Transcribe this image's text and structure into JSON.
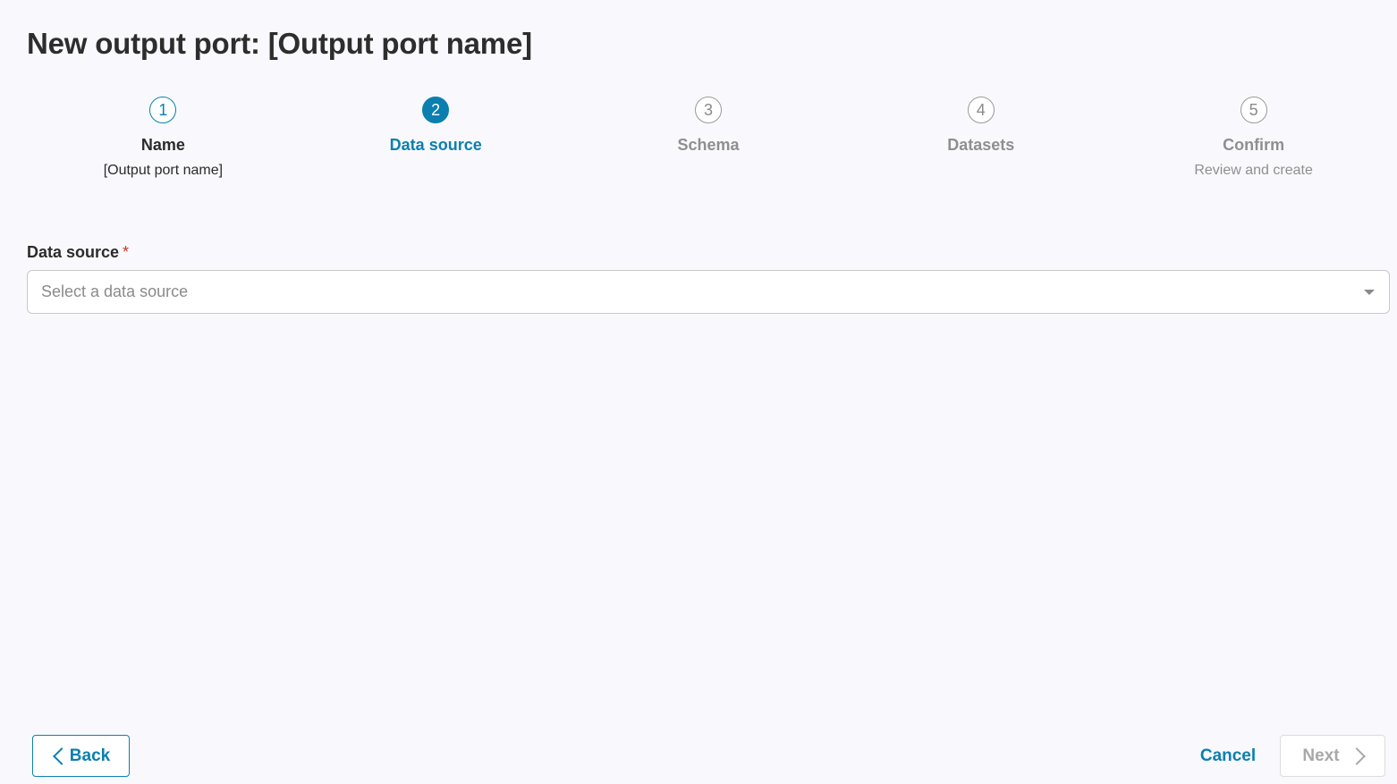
{
  "page": {
    "title": "New output port: [Output port name]"
  },
  "stepper": {
    "steps": [
      {
        "number": "1",
        "title": "Name",
        "subtitle": "[Output port name]",
        "state": "done"
      },
      {
        "number": "2",
        "title": "Data source",
        "subtitle": "",
        "state": "active"
      },
      {
        "number": "3",
        "title": "Schema",
        "subtitle": "",
        "state": "pending"
      },
      {
        "number": "4",
        "title": "Datasets",
        "subtitle": "",
        "state": "pending"
      },
      {
        "number": "5",
        "title": "Confirm",
        "subtitle": "Review and create",
        "state": "pending"
      }
    ]
  },
  "form": {
    "data_source_label": "Data source",
    "required_marker": "*",
    "data_source_placeholder": "Select a data source",
    "data_source_icon": "caret-down-icon"
  },
  "footer": {
    "back_label": "Back",
    "cancel_label": "Cancel",
    "next_label": "Next"
  },
  "colors": {
    "accent": "#0a7fb0",
    "required": "#d0342c",
    "background": "#f9f9fd"
  }
}
